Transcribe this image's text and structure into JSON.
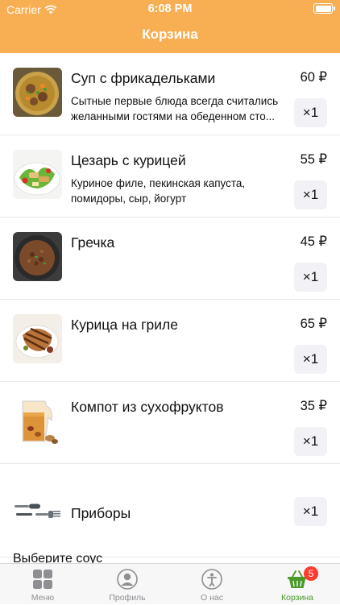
{
  "status": {
    "carrier": "Carrier",
    "time": "6:08 PM"
  },
  "header": {
    "title": "Корзина"
  },
  "cart": {
    "items": [
      {
        "name": "Суп с фрикадельками",
        "desc1": "Сытные первые блюда всегда считались",
        "desc2": "желанными гостями на обеденном сто...",
        "price": "60 ₽",
        "qty": "×1"
      },
      {
        "name": "Цезарь с курицей",
        "desc1": "Куриное филе, пекинская капуста,",
        "desc2": "помидоры, сыр, йогурт",
        "price": "55 ₽",
        "qty": "×1"
      },
      {
        "name": "Гречка",
        "price": "45 ₽",
        "qty": "×1"
      },
      {
        "name": "Курица на гриле",
        "price": "65 ₽",
        "qty": "×1"
      },
      {
        "name": "Компот из сухофруктов",
        "price": "35 ₽",
        "qty": "×1"
      },
      {
        "name": "Приборы",
        "qty": "×1"
      }
    ],
    "sauce_label": "Выберите соус"
  },
  "tabbar": {
    "menu": "Меню",
    "profile": "Профиль",
    "about": "О нас",
    "cart": "Корзина",
    "cart_badge": "5"
  },
  "colors": {
    "accent": "#F8AE52",
    "active_tab": "#4a9a2a",
    "badge": "#ff3b30"
  }
}
